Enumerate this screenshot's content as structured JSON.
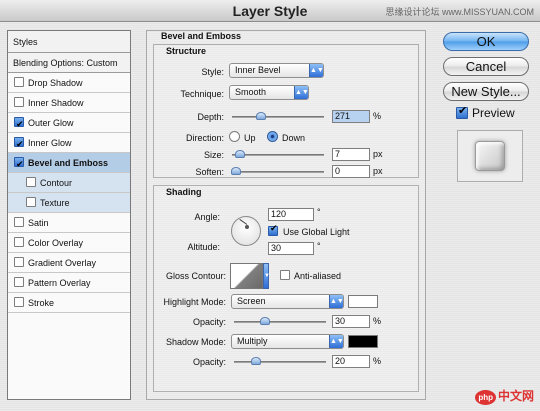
{
  "window": {
    "title": "Layer Style",
    "watermark": "思缘设计论坛  www.MISSYUAN.COM"
  },
  "left_panel": {
    "styles_label": "Styles",
    "blending_label": "Blending Options: Custom",
    "items": [
      {
        "label": "Drop Shadow",
        "checked": false
      },
      {
        "label": "Inner Shadow",
        "checked": false
      },
      {
        "label": "Outer Glow",
        "checked": true
      },
      {
        "label": "Inner Glow",
        "checked": true
      },
      {
        "label": "Bevel and Emboss",
        "checked": true,
        "active": true
      },
      {
        "label": "Contour",
        "checked": false,
        "sub": true
      },
      {
        "label": "Texture",
        "checked": false,
        "sub": true
      },
      {
        "label": "Satin",
        "checked": false
      },
      {
        "label": "Color Overlay",
        "checked": false
      },
      {
        "label": "Gradient Overlay",
        "checked": false
      },
      {
        "label": "Pattern Overlay",
        "checked": false
      },
      {
        "label": "Stroke",
        "checked": false
      }
    ]
  },
  "bevel": {
    "title": "Bevel and Emboss",
    "structure": {
      "title": "Structure",
      "style_label": "Style:",
      "style_value": "Inner Bevel",
      "technique_label": "Technique:",
      "technique_value": "Smooth",
      "depth_label": "Depth:",
      "depth_value": "271",
      "depth_unit": "%",
      "depth_level": 0.27,
      "direction_label": "Direction:",
      "direction_up": "Up",
      "direction_down": "Down",
      "direction_selected": "Down",
      "size_label": "Size:",
      "size_value": "7",
      "size_unit": "px",
      "size_level": 0.05,
      "soften_label": "Soften:",
      "soften_value": "0",
      "soften_unit": "px",
      "soften_level": 0.0
    },
    "shading": {
      "title": "Shading",
      "angle_label": "Angle:",
      "angle_value": "120",
      "angle_unit": "°",
      "global_light_label": "Use Global Light",
      "global_light_checked": true,
      "altitude_label": "Altitude:",
      "altitude_value": "30",
      "altitude_unit": "°",
      "gloss_contour_label": "Gloss Contour:",
      "anti_aliased_label": "Anti-aliased",
      "anti_aliased_checked": false,
      "highlight_mode_label": "Highlight Mode:",
      "highlight_mode_value": "Screen",
      "highlight_color": "#ffffff",
      "highlight_opacity_label": "Opacity:",
      "highlight_opacity_value": "30",
      "highlight_opacity_unit": "%",
      "highlight_opacity_level": 0.3,
      "shadow_mode_label": "Shadow Mode:",
      "shadow_mode_value": "Multiply",
      "shadow_color": "#000000",
      "shadow_opacity_label": "Opacity:",
      "shadow_opacity_value": "20",
      "shadow_opacity_unit": "%",
      "shadow_opacity_level": 0.2
    }
  },
  "actions": {
    "ok": "OK",
    "cancel": "Cancel",
    "new_style": "New Style...",
    "preview_label": "Preview",
    "preview_checked": true
  },
  "logo_text": "中文网",
  "logo_badge": "php"
}
